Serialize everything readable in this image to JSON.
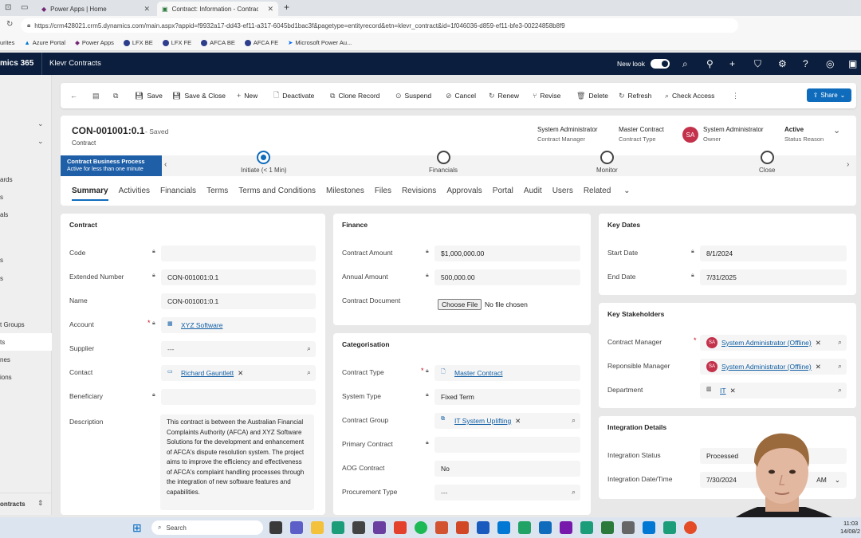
{
  "browser": {
    "tabs": [
      {
        "label": "Power Apps | Home"
      },
      {
        "label": "Contract: Information - Contract"
      }
    ],
    "url": "https://crm428021.crm5.dynamics.com/main.aspx?appid=f9932a17-dd43-ef11-a317-6045bd1bac3f&pagetype=entityrecord&etn=klevr_contract&id=1f046036-d859-ef11-bfe3-00224858b8f9",
    "favorites": [
      "urites",
      "Azure Portal",
      "Power Apps",
      "LFX BE",
      "LFX FE",
      "AFCA BE",
      "AFCA FE",
      "Microsoft Power Au..."
    ]
  },
  "appheader": {
    "brand": "mics 365",
    "app": "Klevr Contracts",
    "new_look": "New look"
  },
  "leftnav": {
    "items": [
      "ards",
      "s",
      "als",
      "s",
      "s",
      "t Groups",
      "ts",
      "nes",
      "ions"
    ],
    "area": "ontracts"
  },
  "commands": [
    "Save",
    "Save & Close",
    "New",
    "Deactivate",
    "Clone Record",
    "Suspend",
    "Cancel",
    "Renew",
    "Revise",
    "Delete",
    "Refresh",
    "Check Access"
  ],
  "share": "Share",
  "record": {
    "title": "CON-001001:0.1",
    "saved": "- Saved",
    "entity": "Contract",
    "header_fields": [
      {
        "value": "System Administrator",
        "label": "Contract Manager"
      },
      {
        "value": "Master Contract",
        "label": "Contract Type"
      },
      {
        "value": "System Administrator",
        "label": "Owner"
      },
      {
        "value": "Active",
        "label": "Status Reason"
      }
    ],
    "owner_initials": "SA"
  },
  "bpf": {
    "name": "Contract Business Process",
    "duration": "Active for less than one minute",
    "stages": [
      "Initiate  (< 1 Min)",
      "Financials",
      "Monitor",
      "Close"
    ]
  },
  "tabs": [
    "Summary",
    "Activities",
    "Financials",
    "Terms",
    "Terms and Conditions",
    "Milestones",
    "Files",
    "Revisions",
    "Approvals",
    "Portal",
    "Audit",
    "Users",
    "Related"
  ],
  "contract": {
    "title": "Contract",
    "code_label": "Code",
    "code": "",
    "ext_label": "Extended Number",
    "ext": "CON-001001:0.1",
    "name_label": "Name",
    "name": "CON-001001:0.1",
    "account_label": "Account",
    "account": "XYZ Software",
    "supplier_label": "Supplier",
    "supplier": "---",
    "contact_label": "Contact",
    "contact": "Richard Gauntlett",
    "beneficiary_label": "Beneficiary",
    "beneficiary": "",
    "description_label": "Description",
    "description": "This contract is between the Australian Financial Complaints Authority (AFCA) and XYZ Software Solutions for the development and enhancement of AFCA's dispute resolution system. The project aims to improve the efficiency and effectiveness of AFCA's complaint handling processes through the integration of new software features and capabilities."
  },
  "finance": {
    "title": "Finance",
    "amount_label": "Contract Amount",
    "amount": "$1,000,000.00",
    "annual_label": "Annual Amount",
    "annual": "500,000.00",
    "doc_label": "Contract Document",
    "choose": "Choose File",
    "nofile": "No file chosen"
  },
  "categorisation": {
    "title": "Categorisation",
    "type_label": "Contract Type",
    "type": "Master Contract",
    "system_label": "System Type",
    "system": "Fixed Term",
    "group_label": "Contract Group",
    "group": "IT System Uplifting",
    "primary_label": "Primary Contract",
    "primary": "",
    "aog_label": "AOG Contract",
    "aog": "No",
    "proc_label": "Procurement Type",
    "proc": "---"
  },
  "keydates": {
    "title": "Key Dates",
    "start_label": "Start Date",
    "start": "8/1/2024",
    "end_label": "End Date",
    "end": "7/31/2025"
  },
  "stakeholders": {
    "title": "Key Stakeholders",
    "cm_label": "Contract Manager",
    "cm": "System Administrator (Offline)",
    "rm_label": "Reponsible Manager",
    "rm": "System Administrator (Offline)",
    "dept_label": "Department",
    "dept": "IT",
    "initials": "SA"
  },
  "integration": {
    "title": "Integration Details",
    "status_label": "Integration Status",
    "status": "Processed",
    "date_label": "Integration Date/Time",
    "date": "7/30/2024",
    "ampm": "AM"
  },
  "taskbar": {
    "search": "Search",
    "time": "11:03",
    "date": "14/08/2"
  }
}
